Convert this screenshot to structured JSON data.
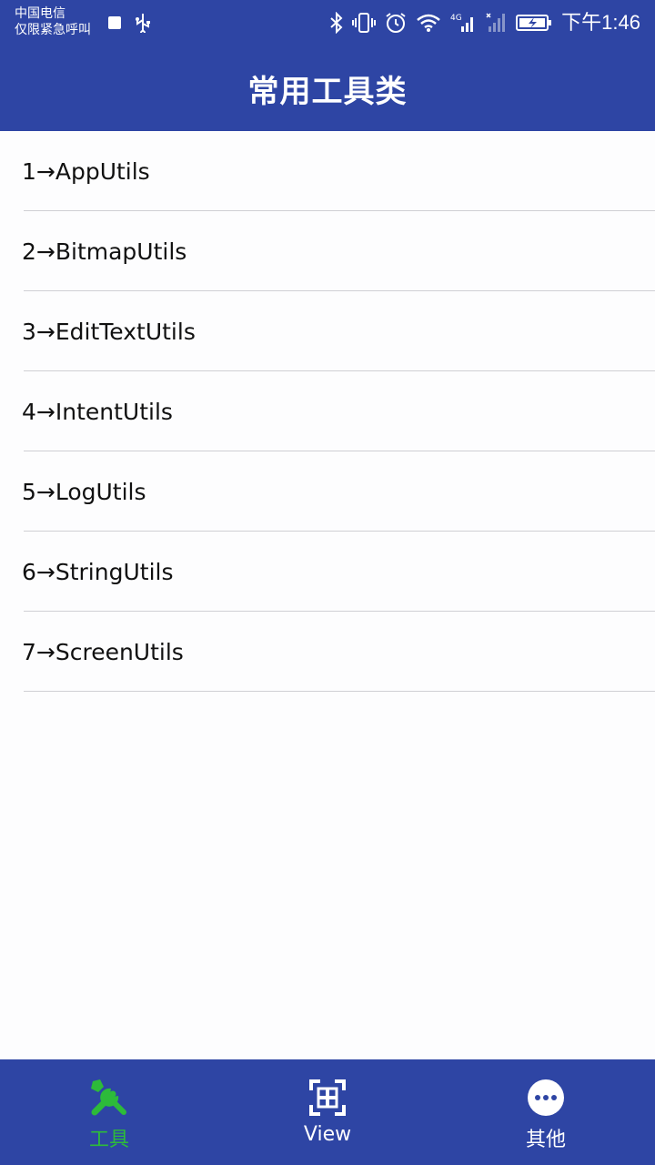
{
  "status_bar": {
    "carrier_line1": "中国电信",
    "carrier_line2": "仅限紧急呼叫",
    "time": "下午1:46",
    "signal_label": "4G",
    "icons": [
      "stop-icon",
      "usb-icon",
      "bluetooth-icon",
      "vibrate-icon",
      "alarm-icon",
      "wifi-icon",
      "signal-4g-icon",
      "signal-icon",
      "battery-charging-icon"
    ]
  },
  "header": {
    "title": "常用工具类"
  },
  "list": {
    "items": [
      {
        "label": "1→AppUtils"
      },
      {
        "label": "2→BitmapUtils"
      },
      {
        "label": "3→EditTextUtils"
      },
      {
        "label": "4→IntentUtils"
      },
      {
        "label": "5→LogUtils"
      },
      {
        "label": "6→StringUtils"
      },
      {
        "label": "7→ScreenUtils"
      }
    ]
  },
  "bottom_nav": {
    "items": [
      {
        "label": "工具",
        "icon": "tools-icon",
        "active": true
      },
      {
        "label": "View",
        "icon": "view-frame-icon",
        "active": false
      },
      {
        "label": "其他",
        "icon": "more-icon",
        "active": false
      }
    ]
  },
  "colors": {
    "primary": "#2e45a4",
    "active": "#2dbb3a",
    "divider": "#cfcfd4"
  }
}
